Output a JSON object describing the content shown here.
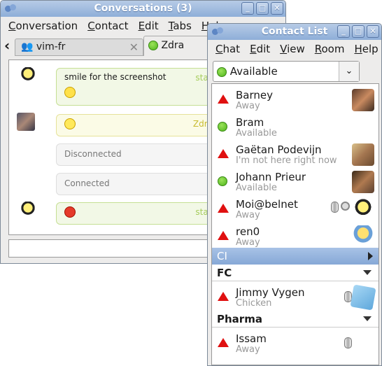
{
  "conversations": {
    "title": "Conversations (3)",
    "menu": [
      "Conversation",
      "Contact",
      "Edit",
      "Tabs",
      "Help"
    ],
    "tabs": [
      {
        "label": "vim-fr",
        "icon": "group-chat-icon"
      },
      {
        "label": "Zdra",
        "icon": "available-icon"
      }
    ],
    "messages": [
      {
        "text": "smile for the screenshot",
        "sender": "staz",
        "emoticon": "smile"
      },
      {
        "text": "",
        "sender": "Zdra",
        "emoticon": "grin"
      },
      {
        "text": "Disconnected",
        "type": "status"
      },
      {
        "text": "Connected",
        "type": "status"
      },
      {
        "text": "",
        "sender": "staz",
        "emoticon": "devil"
      }
    ],
    "input_value": ""
  },
  "contact_list": {
    "title": "Contact List",
    "menu": [
      "Chat",
      "Edit",
      "View",
      "Room",
      "Help"
    ],
    "presence": "Available",
    "contacts": [
      {
        "name": "Barney",
        "status": "Away",
        "presence": "away"
      },
      {
        "name": "Bram",
        "status": "Available",
        "presence": "available"
      },
      {
        "name": "Gaëtan Podevijn",
        "status": "I'm not here right now",
        "presence": "away"
      },
      {
        "name": "Johann Prieur",
        "status": "Available",
        "presence": "available"
      },
      {
        "name": "Moi@belnet",
        "status": "Away",
        "presence": "away"
      },
      {
        "name": "ren0",
        "status": "Away",
        "presence": "away"
      }
    ],
    "groups": [
      {
        "name": "CI",
        "expanded": false
      },
      {
        "name": "FC",
        "expanded": true,
        "contacts": [
          {
            "name": "Jimmy Vygen",
            "status": "Chicken",
            "presence": "away"
          }
        ]
      },
      {
        "name": "Pharma",
        "expanded": true,
        "contacts": [
          {
            "name": "Issam",
            "status": "Away",
            "presence": "away"
          }
        ]
      }
    ],
    "colors": {
      "selected_group": "#8eaed8",
      "away": "#e01010",
      "available": "#4fb51c"
    }
  }
}
